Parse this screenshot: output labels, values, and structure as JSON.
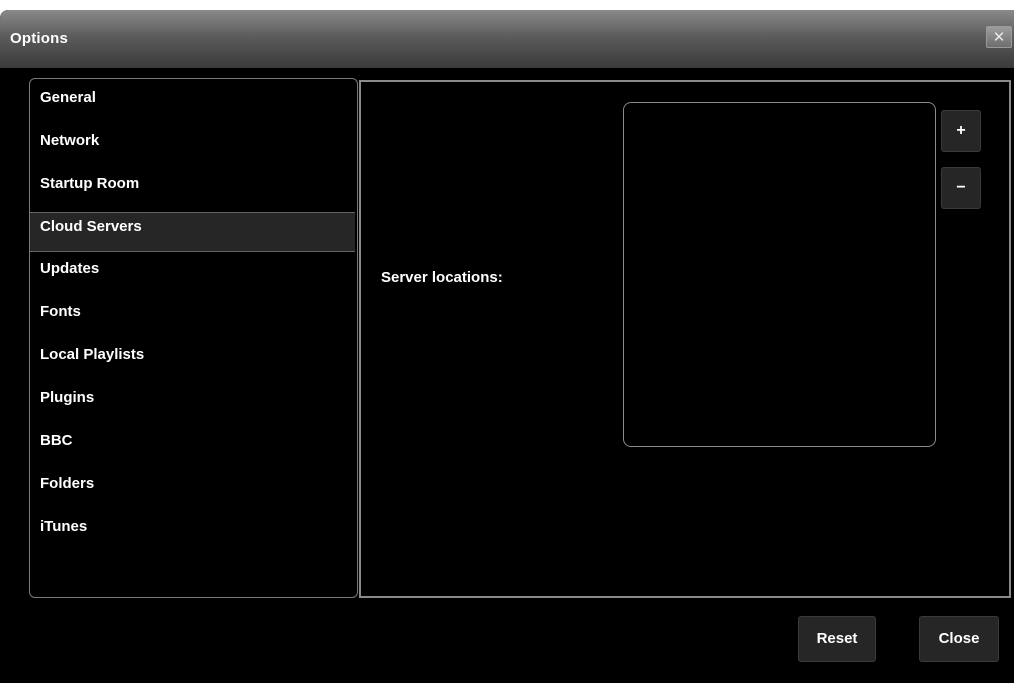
{
  "window": {
    "title": "Options",
    "close_glyph": "✕"
  },
  "sidebar": {
    "selected": "Cloud Servers",
    "items": [
      {
        "label": "General"
      },
      {
        "label": "Network"
      },
      {
        "label": "Startup Room"
      },
      {
        "label": "Cloud Servers"
      },
      {
        "label": "Updates"
      },
      {
        "label": "Fonts"
      },
      {
        "label": "Local Playlists"
      },
      {
        "label": "Plugins"
      },
      {
        "label": "BBC"
      },
      {
        "label": "Folders"
      },
      {
        "label": "iTunes"
      }
    ]
  },
  "content": {
    "server_locations_label": "Server locations:",
    "add_label": "+",
    "remove_label": "−",
    "servers": []
  },
  "footer": {
    "reset_label": "Reset",
    "close_label": "Close"
  },
  "colors": {
    "background": "#000000",
    "titlebar": "#5c5c5c",
    "selected_item": "#262626",
    "button": "#262626",
    "text": "#ffffff"
  }
}
